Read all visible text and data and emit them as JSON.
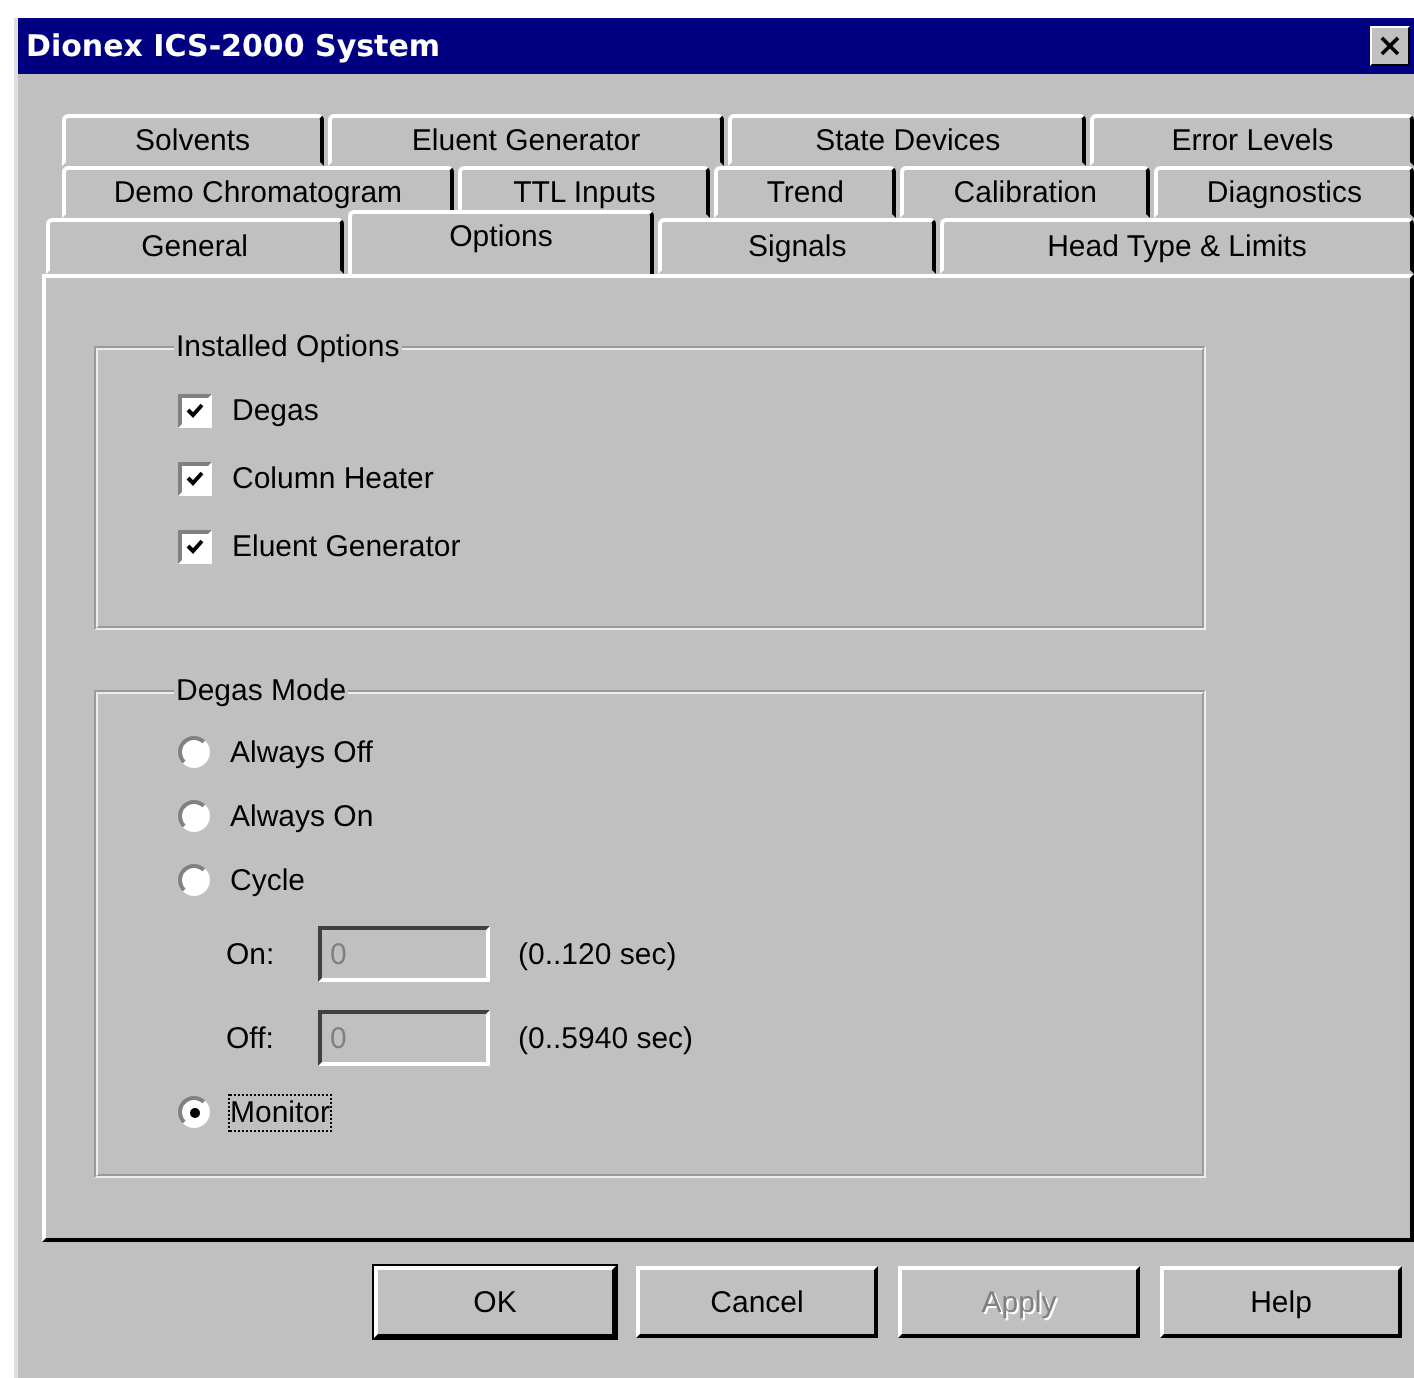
{
  "window": {
    "title": "Dionex ICS-2000 System",
    "close": "×"
  },
  "tab_rows": [
    [
      {
        "label": "Solvents",
        "selected": false
      },
      {
        "label": "Eluent Generator",
        "selected": false
      },
      {
        "label": "State Devices",
        "selected": false
      },
      {
        "label": "Error Levels",
        "selected": false
      }
    ],
    [
      {
        "label": "Demo Chromatogram",
        "selected": false
      },
      {
        "label": "TTL Inputs",
        "selected": false
      },
      {
        "label": "Trend",
        "selected": false
      },
      {
        "label": "Calibration",
        "selected": false
      },
      {
        "label": "Diagnostics",
        "selected": false
      }
    ],
    [
      {
        "label": "General",
        "selected": false
      },
      {
        "label": "Options",
        "selected": true
      },
      {
        "label": "Signals",
        "selected": false
      },
      {
        "label": "Head Type & Limits",
        "selected": false
      }
    ]
  ],
  "installed_options": {
    "title": "Installed Options",
    "items": [
      {
        "label": "Degas",
        "checked": true
      },
      {
        "label": "Column Heater",
        "checked": true
      },
      {
        "label": "Eluent Generator",
        "checked": true
      }
    ]
  },
  "degas_mode": {
    "title": "Degas Mode",
    "options": [
      {
        "label": "Always Off",
        "selected": false
      },
      {
        "label": "Always On",
        "selected": false
      },
      {
        "label": "Cycle",
        "selected": false
      },
      {
        "label": "Monitor",
        "selected": true
      }
    ],
    "fields": [
      {
        "label": "On:",
        "value": "0",
        "range": "(0..120 sec)",
        "disabled": true
      },
      {
        "label": "Off:",
        "value": "0",
        "range": "(0..5940 sec)",
        "disabled": true
      }
    ]
  },
  "buttons": [
    {
      "label": "OK",
      "disabled": false
    },
    {
      "label": "Cancel",
      "disabled": false
    },
    {
      "label": "Apply",
      "disabled": true
    },
    {
      "label": "Help",
      "disabled": false
    }
  ]
}
